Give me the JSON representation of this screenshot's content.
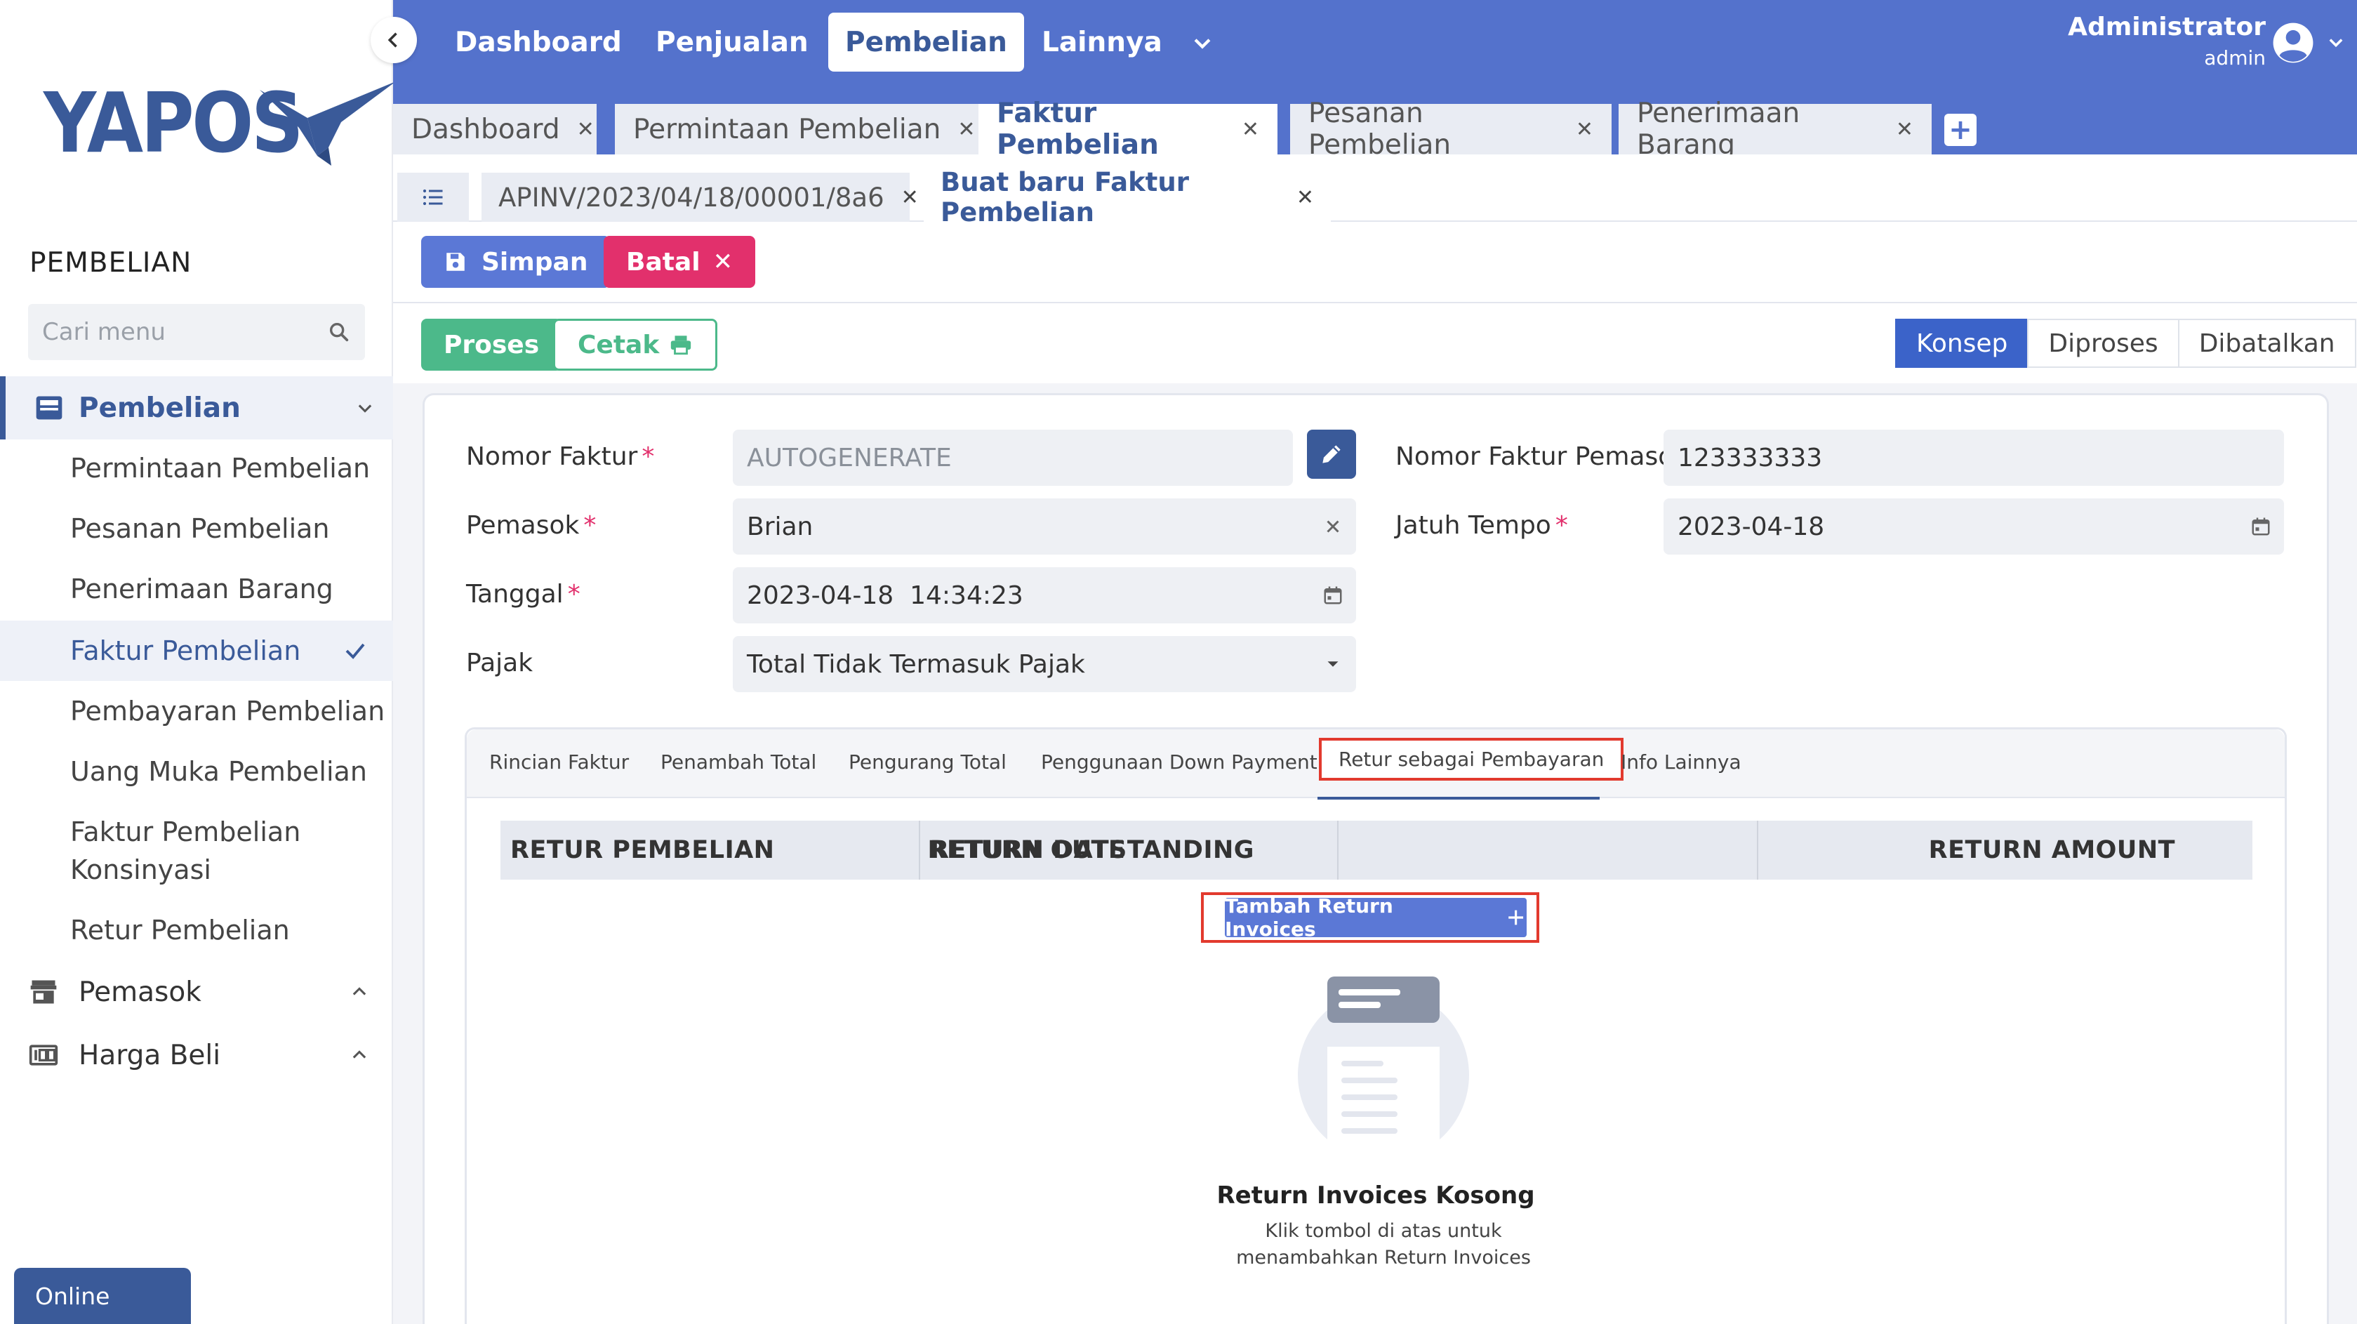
{
  "brand": {
    "logo_text": "YAPOS",
    "color": "#3a5a99"
  },
  "sidebar": {
    "title": "PEMBELIAN",
    "search_placeholder": "Cari menu",
    "groups": [
      {
        "label": "Pembelian",
        "icon": "inbox-tray-icon",
        "expanded": true
      },
      {
        "label": "Pemasok",
        "icon": "store-icon",
        "expanded": false
      },
      {
        "label": "Harga Beli",
        "icon": "price-tag-icon",
        "expanded": false
      }
    ],
    "items": [
      {
        "label": "Permintaan Pembelian"
      },
      {
        "label": "Pesanan Pembelian"
      },
      {
        "label": "Penerimaan Barang"
      },
      {
        "label": "Faktur Pembelian",
        "active": true
      },
      {
        "label": "Pembayaran Pembelian"
      },
      {
        "label": "Uang Muka Pembelian"
      },
      {
        "label": "Faktur Pembelian Konsinyasi"
      },
      {
        "label": "Retur Pembelian"
      }
    ],
    "status": "Online"
  },
  "topnav": {
    "items": [
      "Dashboard",
      "Penjualan",
      "Pembelian",
      "Lainnya"
    ],
    "active": "Pembelian",
    "user": {
      "name": "Administrator",
      "role": "admin"
    }
  },
  "tabs": [
    {
      "label": "Dashboard"
    },
    {
      "label": "Permintaan Pembelian"
    },
    {
      "label": "Faktur Pembelian",
      "active": true
    },
    {
      "label": "Pesanan Pembelian"
    },
    {
      "label": "Penerimaan Barang"
    }
  ],
  "tab_add_label": "+",
  "subtabs": [
    {
      "label": "APINV/2023/04/18/00001/8a6"
    },
    {
      "label": "Buat baru Faktur Pembelian",
      "active": true
    }
  ],
  "toolbar": {
    "save_label": "Simpan",
    "cancel_label": "Batal"
  },
  "actions": {
    "process_label": "Proses",
    "print_label": "Cetak"
  },
  "status_steps": [
    {
      "label": "Konsep",
      "active": true
    },
    {
      "label": "Diproses"
    },
    {
      "label": "Dibatalkan"
    }
  ],
  "form": {
    "nomor_faktur": {
      "label": "Nomor Faktur",
      "value": "AUTOGENERATE"
    },
    "pemasok": {
      "label": "Pemasok",
      "value": "Brian"
    },
    "tanggal": {
      "label": "Tanggal",
      "value": "2023-04-18  14:34:23"
    },
    "pajak": {
      "label": "Pajak",
      "value": "Total Tidak Termasuk Pajak"
    },
    "nomor_faktur_pemasok": {
      "label": "Nomor Faktur Pemasok",
      "value": "123333333"
    },
    "jatuh_tempo": {
      "label": "Jatuh Tempo",
      "value": "2023-04-18"
    },
    "required_mark": "*"
  },
  "inner_tabs": [
    {
      "label": "Rincian Faktur"
    },
    {
      "label": "Penambah Total"
    },
    {
      "label": "Pengurang Total"
    },
    {
      "label": "Penggunaan Down Payment"
    },
    {
      "label": "Retur sebagai Pembayaran",
      "active": true
    },
    {
      "label": "Info Lainnya"
    }
  ],
  "table": {
    "columns": [
      "RETUR PEMBELIAN",
      "RETURN DATE",
      "RETURN OUTSTANDING",
      "RETURN AMOUNT"
    ],
    "rows": []
  },
  "add_button_label": "Tambah Return Invoices",
  "empty": {
    "title": "Return Invoices Kosong",
    "subtitle": "Klik tombol di atas untuk menambahkan Return Invoices"
  },
  "colors": {
    "topbar": "#5472cc",
    "primary": "#5b78d6",
    "danger": "#e2306c",
    "success": "#4cb98a",
    "highlight": "#e23a2e"
  }
}
